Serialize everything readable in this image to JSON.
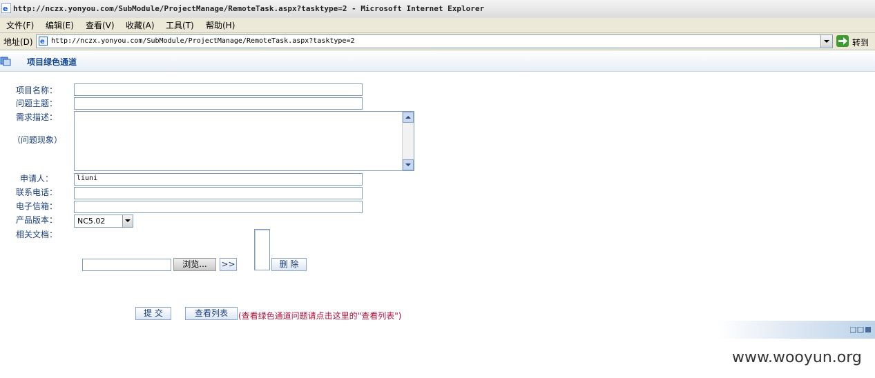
{
  "window": {
    "title": "http://nczx.yonyou.com/SubModule/ProjectManage/RemoteTask.aspx?tasktype=2 - Microsoft Internet Explorer",
    "menu": [
      "文件(F)",
      "编辑(E)",
      "查看(V)",
      "收藏(A)",
      "工具(T)",
      "帮助(H)"
    ],
    "address_label": "地址(D)",
    "address_url": "http://nczx.yonyou.com/SubModule/ProjectManage/RemoteTask.aspx?tasktype=2",
    "go_label": "转到"
  },
  "page": {
    "title": "项目绿色通道"
  },
  "form": {
    "project_name_label": "项目名称：",
    "project_name_value": "",
    "subject_label": "问题主题：",
    "subject_value": "",
    "description_label": "需求描述：",
    "description_sublabel": "（问题现象）",
    "description_value": "",
    "applicant_label": "申请人：",
    "applicant_value": "liuni",
    "phone_label": "联系电话：",
    "phone_value": "",
    "email_label": "电子信箱：",
    "email_value": "",
    "version_label": "产品版本：",
    "version_value": "NC5.02",
    "docs_label": "相关文档：",
    "file_path_value": "",
    "browse_label": "浏览...",
    "add_label": ">>",
    "delete_label": "删 除"
  },
  "actions": {
    "submit_label": "提 交",
    "view_list_label": "查看列表",
    "note": "(查看绿色通道问题请点击这里的\"查看列表\")"
  },
  "watermark": "www.wooyun.org",
  "colors": {
    "label_blue": "#1a3e78",
    "note_red": "#b0103a",
    "field_border": "#7f9db9"
  }
}
